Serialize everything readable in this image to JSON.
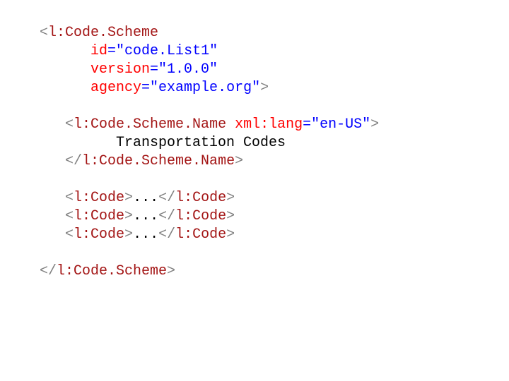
{
  "tokens": [
    [
      [
        "bracket",
        "<"
      ],
      [
        "elem",
        "l:Code.Scheme"
      ]
    ],
    [
      [
        "text",
        "      "
      ],
      [
        "attr",
        "id"
      ],
      [
        "equals",
        "="
      ],
      [
        "value",
        "\"code.List1\""
      ]
    ],
    [
      [
        "text",
        "      "
      ],
      [
        "attr",
        "version"
      ],
      [
        "equals",
        "="
      ],
      [
        "value",
        "\"1.0.0\""
      ]
    ],
    [
      [
        "text",
        "      "
      ],
      [
        "attr",
        "agency"
      ],
      [
        "equals",
        "="
      ],
      [
        "value",
        "\"example.org\""
      ],
      [
        "bracket",
        ">"
      ]
    ],
    [],
    [
      [
        "text",
        "   "
      ],
      [
        "bracket",
        "<"
      ],
      [
        "elem",
        "l:Code.Scheme.Name"
      ],
      [
        "text",
        " "
      ],
      [
        "attr",
        "xml:lang"
      ],
      [
        "equals",
        "="
      ],
      [
        "value",
        "\"en-US\""
      ],
      [
        "bracket",
        ">"
      ]
    ],
    [
      [
        "text",
        "         Transportation Codes"
      ]
    ],
    [
      [
        "text",
        "   "
      ],
      [
        "bracket",
        "</"
      ],
      [
        "elem",
        "l:Code.Scheme.Name"
      ],
      [
        "bracket",
        ">"
      ]
    ],
    [],
    [
      [
        "text",
        "   "
      ],
      [
        "bracket",
        "<"
      ],
      [
        "elem",
        "l:Code"
      ],
      [
        "bracket",
        ">"
      ],
      [
        "text",
        "..."
      ],
      [
        "bracket",
        "</"
      ],
      [
        "elem",
        "l:Code"
      ],
      [
        "bracket",
        ">"
      ]
    ],
    [
      [
        "text",
        "   "
      ],
      [
        "bracket",
        "<"
      ],
      [
        "elem",
        "l:Code"
      ],
      [
        "bracket",
        ">"
      ],
      [
        "text",
        "..."
      ],
      [
        "bracket",
        "</"
      ],
      [
        "elem",
        "l:Code"
      ],
      [
        "bracket",
        ">"
      ]
    ],
    [
      [
        "text",
        "   "
      ],
      [
        "bracket",
        "<"
      ],
      [
        "elem",
        "l:Code"
      ],
      [
        "bracket",
        ">"
      ],
      [
        "text",
        "..."
      ],
      [
        "bracket",
        "</"
      ],
      [
        "elem",
        "l:Code"
      ],
      [
        "bracket",
        ">"
      ]
    ],
    [],
    [
      [
        "bracket",
        "</"
      ],
      [
        "elem",
        "l:Code.Scheme"
      ],
      [
        "bracket",
        ">"
      ]
    ]
  ]
}
